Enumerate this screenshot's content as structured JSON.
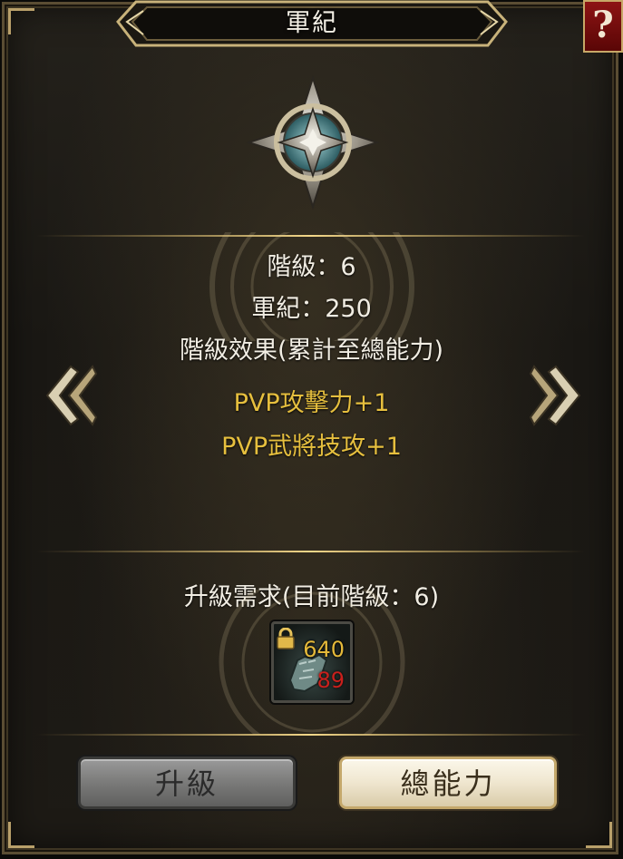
{
  "window": {
    "title": "軍紀",
    "help_label": "?"
  },
  "info": {
    "rank_line": "階級：6",
    "points_line": "軍紀：250",
    "effect_header": "階級效果(累計至總能力)",
    "effects": [
      "PVP攻擊力+1",
      "PVP武將技攻+1"
    ]
  },
  "requirement": {
    "header": "升級需求(目前階級：6)",
    "item_icon": "gauntlet-icon",
    "have": "640",
    "need": "89"
  },
  "buttons": {
    "upgrade": "升級",
    "total_stats": "總能力"
  },
  "colors": {
    "gold_text": "#e6bf3e",
    "need_red": "#c8201c",
    "panel_border": "#b9a06a"
  }
}
